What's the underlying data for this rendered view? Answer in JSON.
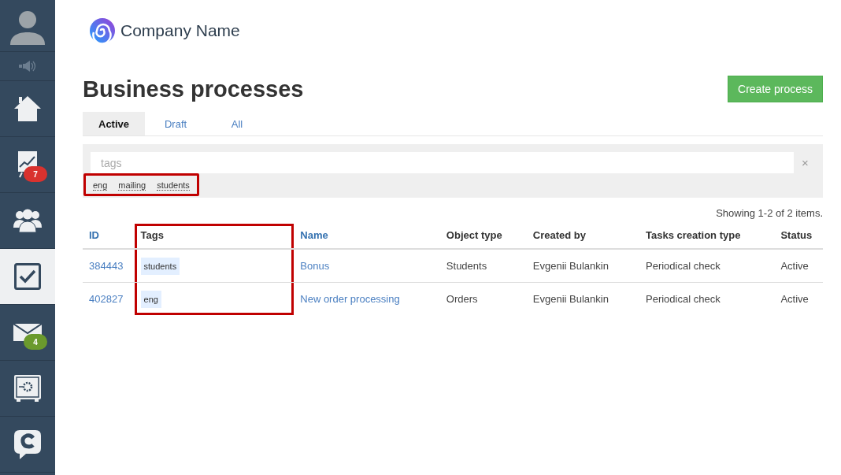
{
  "sidebar": {
    "items": [
      {
        "kind": "avatar",
        "selected": false
      },
      {
        "kind": "speaker",
        "selected": false
      },
      {
        "kind": "home",
        "selected": false
      },
      {
        "kind": "chart",
        "selected": false,
        "badge": "7",
        "color": "#d9322e"
      },
      {
        "kind": "people",
        "selected": false
      },
      {
        "kind": "tasks",
        "selected": true
      },
      {
        "kind": "mail",
        "selected": false,
        "badge": "4",
        "color": "#6b9a2d"
      },
      {
        "kind": "safe",
        "selected": false
      },
      {
        "kind": "chat",
        "selected": false
      }
    ]
  },
  "header": {
    "company": "Company Name"
  },
  "page": {
    "title": "Business processes",
    "create_button": "Create process"
  },
  "tabs": [
    {
      "label": "Active",
      "selected": true
    },
    {
      "label": "Draft",
      "selected": false
    },
    {
      "label": "All",
      "selected": false
    }
  ],
  "filter": {
    "placeholder": "tags",
    "clear": "×",
    "highlighted": true,
    "tags": [
      "eng",
      "mailing",
      "students"
    ]
  },
  "summary": "Showing 1-2 of 2 items.",
  "table": {
    "columns": [
      {
        "label": "ID",
        "sortable": true,
        "highlighted": false
      },
      {
        "label": "Tags",
        "sortable": false,
        "highlighted": true
      },
      {
        "label": "Name",
        "sortable": true,
        "highlighted": false
      },
      {
        "label": "Object type",
        "sortable": false,
        "highlighted": false
      },
      {
        "label": "Created by",
        "sortable": false,
        "highlighted": false
      },
      {
        "label": "Tasks creation type",
        "sortable": false,
        "highlighted": false
      },
      {
        "label": "Status",
        "sortable": false,
        "highlighted": false
      }
    ],
    "rows": [
      {
        "id": "384443",
        "tags": [
          "students"
        ],
        "name": "Bonus",
        "object_type": "Students",
        "created_by": "Evgenii Bulankin",
        "tasks_creation_type": "Periodical check",
        "status": "Active"
      },
      {
        "id": "402827",
        "tags": [
          "eng"
        ],
        "name": "New order processing",
        "object_type": "Orders",
        "created_by": "Evgenii Bulankin",
        "tasks_creation_type": "Periodical check",
        "status": "Active"
      }
    ]
  }
}
